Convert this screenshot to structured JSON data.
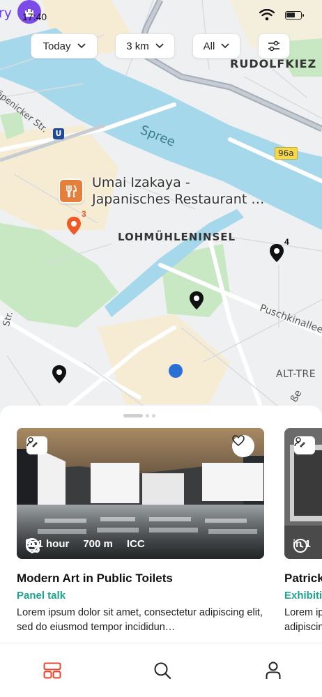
{
  "status_bar": {
    "app_fragment": "ry",
    "avatar_icon": "castle-icon",
    "time": "17:40",
    "wifi_icon": "wifi-icon",
    "battery_icon": "battery-icon"
  },
  "filters": {
    "date": "Today",
    "distance": "3 km",
    "category": "All",
    "settings_icon": "sliders-icon"
  },
  "map": {
    "labels": {
      "district_ne": "RUDOLFKIEZ",
      "street_nw": "Köpenicker Str.",
      "river": "Spree",
      "road_badge": "96a",
      "island": "LOHMÜHLENINSEL",
      "street_e": "Puschkinallee",
      "district_se": "ALT-TRE",
      "street_se": "ße",
      "street_w": "Str.",
      "ubahn": "U"
    },
    "poi": {
      "name_line1": "Umai Izakaya -",
      "name_line2": "Japanisches Restaurant …",
      "icon": "restaurant-icon"
    },
    "pin_counts": {
      "orange": "3",
      "black": "4"
    },
    "colors": {
      "water": "#a6d8ec",
      "park": "#c8e8c4",
      "land": "#eef0f1",
      "accent_orange": "#f15a24",
      "user_location": "#2a6fd6"
    }
  },
  "events": [
    {
      "category_icon": "edit-person-icon",
      "time": "in 1 hour",
      "distance": "700 m",
      "venue": "ICC",
      "title": "Modern Art in Public Toilets",
      "category": "Panel talk",
      "description": "Lorem ipsum dolor sit amet, consectetur adipiscing elit, sed do eiusmod tempor incididun…"
    },
    {
      "category_icon": "edit-person-icon",
      "time": "in 1",
      "title": "Patrick",
      "category": "Exhibition",
      "description": "Lorem ip adipiscin"
    }
  ],
  "nav": {
    "home_icon": "cards-icon",
    "search_icon": "search-icon",
    "profile_icon": "profile-icon",
    "active_color": "#e8452c"
  },
  "accent_green": "#1aa58c"
}
